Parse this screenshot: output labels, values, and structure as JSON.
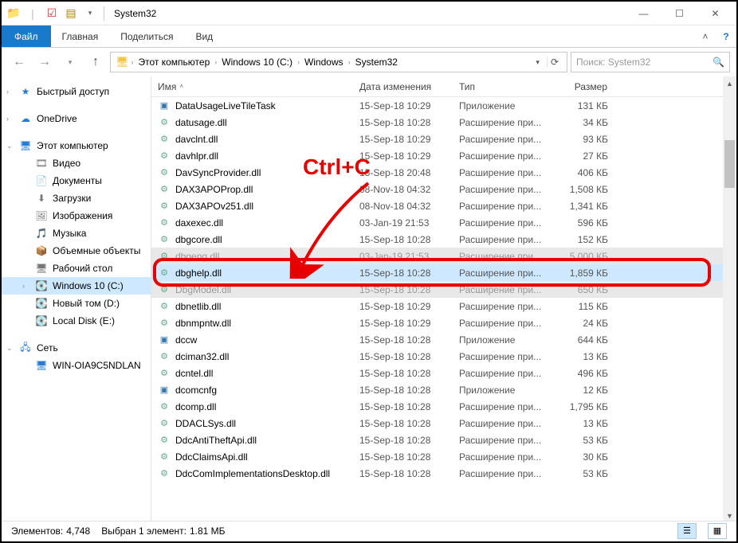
{
  "window": {
    "title": "System32"
  },
  "win_buttons": {
    "min": "—",
    "max": "☐",
    "close": "✕"
  },
  "ribbon": {
    "file": "Файл",
    "tabs": [
      "Главная",
      "Поделиться",
      "Вид"
    ]
  },
  "nav_arrows": {
    "back": "←",
    "fwd": "→",
    "recent": "▾",
    "up": "↑"
  },
  "breadcrumbs": [
    "Этот компьютер",
    "Windows 10 (C:)",
    "Windows",
    "System32"
  ],
  "search": {
    "placeholder": "Поиск: System32"
  },
  "sidebar": {
    "quick": {
      "label": "Быстрый доступ",
      "icon": "★"
    },
    "onedrive": {
      "label": "OneDrive",
      "icon": "☁"
    },
    "thispc": {
      "label": "Этот компьютер",
      "icon": "🖥"
    },
    "thispc_children": [
      {
        "label": "Видео",
        "icon": "🎞"
      },
      {
        "label": "Документы",
        "icon": "📄"
      },
      {
        "label": "Загрузки",
        "icon": "⬇"
      },
      {
        "label": "Изображения",
        "icon": "🖼"
      },
      {
        "label": "Музыка",
        "icon": "🎵"
      },
      {
        "label": "Объемные объекты",
        "icon": "📦"
      },
      {
        "label": "Рабочий стол",
        "icon": "🖥"
      },
      {
        "label": "Windows 10 (C:)",
        "icon": "💽",
        "selected": true
      },
      {
        "label": "Новый том (D:)",
        "icon": "💽"
      },
      {
        "label": "Local Disk (E:)",
        "icon": "💽"
      }
    ],
    "network": {
      "label": "Сеть",
      "icon": "🖧"
    },
    "network_children": [
      {
        "label": "WIN-OIA9C5NDLAN",
        "icon": "🖥"
      }
    ]
  },
  "columns": {
    "name": "Имя",
    "date": "Дата изменения",
    "type": "Тип",
    "size": "Размер"
  },
  "files": [
    {
      "name": "DataUsageLiveTileTask",
      "date": "15-Sep-18 10:29",
      "type": "Приложение",
      "size": "131 КБ",
      "icon": "exe"
    },
    {
      "name": "datusage.dll",
      "date": "15-Sep-18 10:28",
      "type": "Расширение при...",
      "size": "34 КБ",
      "icon": "dll"
    },
    {
      "name": "davclnt.dll",
      "date": "15-Sep-18 10:29",
      "type": "Расширение при...",
      "size": "93 КБ",
      "icon": "dll"
    },
    {
      "name": "davhlpr.dll",
      "date": "15-Sep-18 10:29",
      "type": "Расширение при...",
      "size": "27 КБ",
      "icon": "dll"
    },
    {
      "name": "DavSyncProvider.dll",
      "date": "15-Sep-18 20:48",
      "type": "Расширение при...",
      "size": "406 КБ",
      "icon": "dll"
    },
    {
      "name": "DAX3APOProp.dll",
      "date": "08-Nov-18 04:32",
      "type": "Расширение при...",
      "size": "1,508 КБ",
      "icon": "dll"
    },
    {
      "name": "DAX3APOv251.dll",
      "date": "08-Nov-18 04:32",
      "type": "Расширение при...",
      "size": "1,341 КБ",
      "icon": "dll"
    },
    {
      "name": "daxexec.dll",
      "date": "03-Jan-19 21:53",
      "type": "Расширение при...",
      "size": "596 КБ",
      "icon": "dll"
    },
    {
      "name": "dbgcore.dll",
      "date": "15-Sep-18 10:28",
      "type": "Расширение при...",
      "size": "152 КБ",
      "icon": "dll"
    },
    {
      "name": "dbgeng.dll",
      "date": "03-Jan-19 21:53",
      "type": "Расширение при...",
      "size": "5,000 КБ",
      "icon": "dll",
      "dim": "above"
    },
    {
      "name": "dbghelp.dll",
      "date": "15-Sep-18 10:28",
      "type": "Расширение при...",
      "size": "1,859 КБ",
      "icon": "dll",
      "selected": true
    },
    {
      "name": "DbgModel.dll",
      "date": "15-Sep-18 10:28",
      "type": "Расширение при...",
      "size": "650 КБ",
      "icon": "dll",
      "dim": "below"
    },
    {
      "name": "dbnetlib.dll",
      "date": "15-Sep-18 10:29",
      "type": "Расширение при...",
      "size": "115 КБ",
      "icon": "dll"
    },
    {
      "name": "dbnmpntw.dll",
      "date": "15-Sep-18 10:29",
      "type": "Расширение при...",
      "size": "24 КБ",
      "icon": "dll"
    },
    {
      "name": "dccw",
      "date": "15-Sep-18 10:28",
      "type": "Приложение",
      "size": "644 КБ",
      "icon": "exe"
    },
    {
      "name": "dciman32.dll",
      "date": "15-Sep-18 10:28",
      "type": "Расширение при...",
      "size": "13 КБ",
      "icon": "dll"
    },
    {
      "name": "dcntel.dll",
      "date": "15-Sep-18 10:28",
      "type": "Расширение при...",
      "size": "496 КБ",
      "icon": "dll"
    },
    {
      "name": "dcomcnfg",
      "date": "15-Sep-18 10:28",
      "type": "Приложение",
      "size": "12 КБ",
      "icon": "exe"
    },
    {
      "name": "dcomp.dll",
      "date": "15-Sep-18 10:28",
      "type": "Расширение при...",
      "size": "1,795 КБ",
      "icon": "dll"
    },
    {
      "name": "DDACLSys.dll",
      "date": "15-Sep-18 10:28",
      "type": "Расширение при...",
      "size": "13 КБ",
      "icon": "dll"
    },
    {
      "name": "DdcAntiTheftApi.dll",
      "date": "15-Sep-18 10:28",
      "type": "Расширение при...",
      "size": "53 КБ",
      "icon": "dll"
    },
    {
      "name": "DdcClaimsApi.dll",
      "date": "15-Sep-18 10:28",
      "type": "Расширение при...",
      "size": "30 КБ",
      "icon": "dll"
    },
    {
      "name": "DdcComImplementationsDesktop.dll",
      "date": "15-Sep-18 10:28",
      "type": "Расширение при...",
      "size": "53 КБ",
      "icon": "dll"
    }
  ],
  "status": {
    "count_label": "Элементов:",
    "count_value": "4,748",
    "sel_label": "Выбран 1 элемент:",
    "sel_size": "1.81 МБ"
  },
  "annotation": {
    "text": "Ctrl+C"
  }
}
